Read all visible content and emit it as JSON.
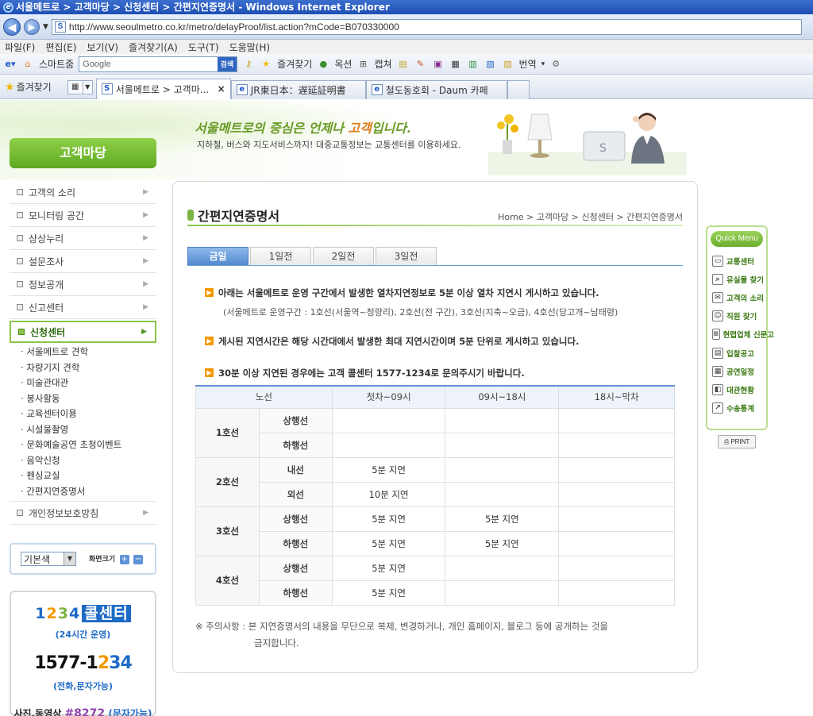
{
  "browser": {
    "window_title": "서울메트로 > 고객마당 > 신청센터 > 간편지연증명서 - Windows Internet Explorer",
    "url": "http://www.seoulmetro.co.kr/metro/delayProof/list.action?mCode=B070330000",
    "menu": [
      "파일(F)",
      "편집(E)",
      "보기(V)",
      "즐겨찾기(A)",
      "도구(T)",
      "도움말(H)"
    ],
    "toolbar": {
      "smartzoom": "스마트줌",
      "search_placeholder": "Google",
      "search_button": "검색",
      "favorites": "즐겨찾기",
      "options": "옥션",
      "capture": "캡쳐",
      "translate": "번역"
    },
    "favorites_label": "즐겨찾기",
    "tabs": [
      {
        "label": "서울메트로 > 고객마...",
        "active": true
      },
      {
        "label": "JR東日本：遅延証明書",
        "active": false
      },
      {
        "label": "철도동호회 - Daum 카페",
        "active": false
      }
    ]
  },
  "site": {
    "slogan_pre": "서울메트로",
    "slogan_mid": "의 중심은 언제나 ",
    "slogan_hl": "고객",
    "slogan_post": "입니다.",
    "slogan_sub": "지하철, 버스와 지도서비스까지! 대중교통정보는 교통센터를 이용하세요.",
    "section": "고객마당"
  },
  "leftnav": {
    "items_before": [
      "고객의 소리",
      "모니터링 공간",
      "상상누리",
      "설문조사",
      "정보공개",
      "신고센터"
    ],
    "active": "신청센터",
    "subitems": [
      "서울메트로 견학",
      "차량기지 견학",
      "미술관대관",
      "봉사활동",
      "교육센터이용",
      "시설물촬영",
      "문화예술공연 초청이벤트",
      "음악신청",
      "펜싱교실",
      "간편지연증명서"
    ],
    "items_after": [
      "개인정보보호방침"
    ]
  },
  "font_control": {
    "color_value": "기본색",
    "zoom_label": "화면크기",
    "plus": "+",
    "minus": "−"
  },
  "callcenter": {
    "d1": "1",
    "d2": "2",
    "d3": "3",
    "d4": "4",
    "center": "콜센터",
    "hours": "(24시간 운영)",
    "number_pre": "1577-1",
    "number_o": "2",
    "number_b": "34",
    "phone_note": "(전화,문자가능)",
    "mms_pre": "사진,동영상 ",
    "mms_num": "#8272",
    "mms_post": " (문자가능)"
  },
  "content": {
    "title": "간편지연증명서",
    "breadcrumb": "Home > 고객마당 > 신청센터 > 간편지연증명서",
    "day_tabs": [
      "금일",
      "1일전",
      "2일전",
      "3일전"
    ],
    "notice1": "아래는 서울메트로 운영 구간에서 발생한 열차지연정보로 5분 이상 열차 지연시 게시하고 있습니다.",
    "notice1_sub": "(서울메트로 운영구간 : 1호선(서울역~청량리), 2호선(전 구간), 3호선(지축~오금), 4호선(당고개~남태령)",
    "notice2": "게시된 지연시간은 해당 시간대에서 발생한 최대 지연시간이며 5분 단위로 게시하고 있습니다.",
    "notice3": "30분 이상 지연된 경우에는 고객 콜센터 1577-1234로 문의주시기 바랍니다.",
    "table": {
      "headers": [
        "노선",
        "첫차~09시",
        "09시~18시",
        "18시~막차"
      ],
      "rows": [
        {
          "line": "1호선",
          "dir": "상행선",
          "c1": "",
          "c2": "",
          "c3": ""
        },
        {
          "line": "",
          "dir": "하행선",
          "c1": "",
          "c2": "",
          "c3": ""
        },
        {
          "line": "2호선",
          "dir": "내선",
          "c1": "5분 지연",
          "c2": "",
          "c3": ""
        },
        {
          "line": "",
          "dir": "외선",
          "c1": "10분 지연",
          "c2": "",
          "c3": ""
        },
        {
          "line": "3호선",
          "dir": "상행선",
          "c1": "5분 지연",
          "c2": "5분 지연",
          "c3": ""
        },
        {
          "line": "",
          "dir": "하행선",
          "c1": "5분 지연",
          "c2": "5분 지연",
          "c3": ""
        },
        {
          "line": "4호선",
          "dir": "상행선",
          "c1": "5분 지연",
          "c2": "",
          "c3": ""
        },
        {
          "line": "",
          "dir": "하행선",
          "c1": "5분 지연",
          "c2": "",
          "c3": ""
        }
      ]
    },
    "caution_line1": "※ 주의사항 : 본 지연증명서의 내용을 무단으로 복제, 변경하거나, 개인 홈페이지, 블로그 등에 공개하는 것을",
    "caution_line2": "금지합니다."
  },
  "quickmenu": {
    "title": "Quick Menu",
    "items": [
      "교통센터",
      "유실물 찾기",
      "고객의 소리",
      "직원 찾기",
      "현렵업체 신문고",
      "입찰공고",
      "공연일정",
      "대관현황",
      "수송통계"
    ],
    "print": "PRINT"
  }
}
